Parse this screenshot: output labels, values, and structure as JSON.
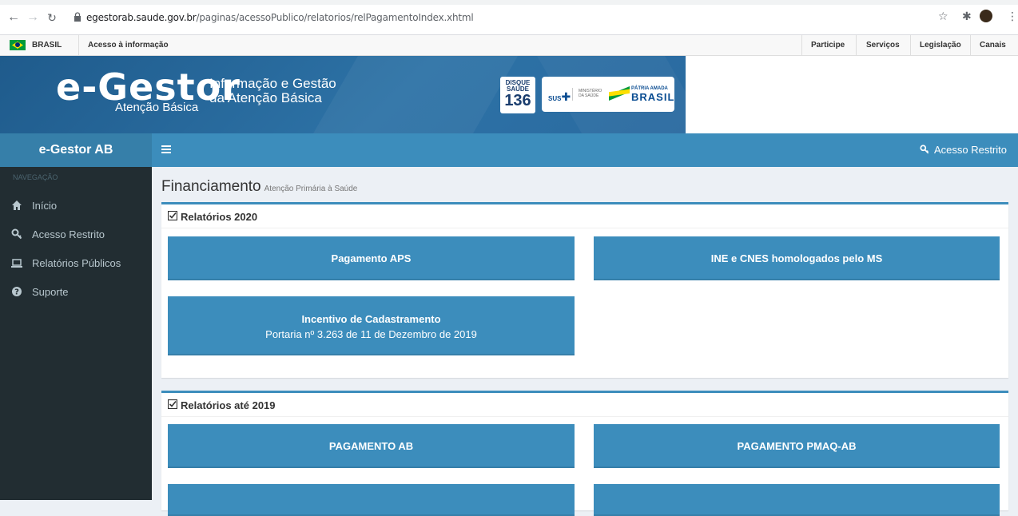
{
  "browser": {
    "url_host": "egestorab.saude.gov.br",
    "url_path": "/paginas/acessoPublico/relatorios/relPagamentoIndex.xhtml"
  },
  "govbar": {
    "country": "BRASIL",
    "info": "Acesso à informação",
    "links": [
      "Participe",
      "Serviços",
      "Legislação",
      "Canais"
    ]
  },
  "banner": {
    "logo": "e-Gestor",
    "logo_sub": "Atenção Básica",
    "tagline_1": "Informação e Gestão",
    "tagline_2": "da Atenção Básica",
    "disque_1": "DISQUE",
    "disque_2": "SAÚDE",
    "disque_3": "136",
    "sus": "SUS",
    "ministerio": "MINISTÉRIO DA SAÚDE",
    "patria": "PÁTRIA AMADA",
    "brasil": "BRASIL"
  },
  "sidebar": {
    "title": "e-Gestor AB",
    "heading": "NAVEGAÇÃO",
    "items": [
      {
        "label": "Início",
        "icon": "home-icon"
      },
      {
        "label": "Acesso Restrito",
        "icon": "key-icon"
      },
      {
        "label": "Relatórios Públicos",
        "icon": "laptop-icon"
      },
      {
        "label": "Suporte",
        "icon": "question-circle-icon"
      }
    ]
  },
  "topnav": {
    "restricted": "Acesso Restrito"
  },
  "content": {
    "title": "Financiamento",
    "subtitle": "Atenção Primária à Saúde",
    "box1": {
      "title": "Relatórios 2020",
      "tiles": [
        {
          "label": "Pagamento APS"
        },
        {
          "label": "INE e CNES homologados pelo MS"
        },
        {
          "label": "Incentivo de Cadastramento",
          "sub": "Portaria nº 3.263 de 11 de Dezembro de 2019"
        }
      ]
    },
    "box2": {
      "title": "Relatórios até 2019",
      "tiles": [
        {
          "label": "PAGAMENTO AB"
        },
        {
          "label": "PAGAMENTO PMAQ-AB"
        }
      ]
    }
  },
  "colors": {
    "primary": "#3c8dbc",
    "primary_dark": "#367fa9",
    "sidebar": "#222d32",
    "banner": "#2d72a6"
  }
}
